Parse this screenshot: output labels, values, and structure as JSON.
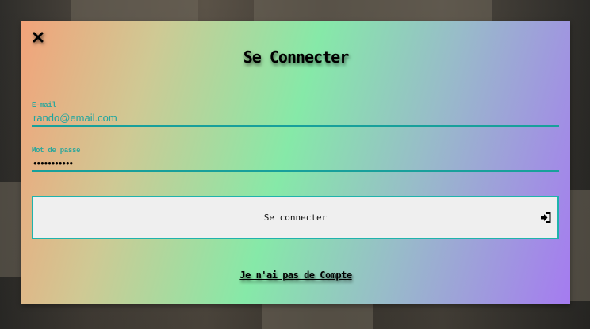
{
  "modal": {
    "title": "Se Connecter",
    "close_icon": "close-icon",
    "email": {
      "label": "E-mail",
      "value": "rando@email.com"
    },
    "password": {
      "label": "Mot de passe",
      "value": "•••••••••••"
    },
    "submit": {
      "label": "Se connecter",
      "icon": "sign-in-icon"
    },
    "no_account_link": "Je n'ai pas de Compte"
  },
  "colors": {
    "accent": "#1fb3ac",
    "label": "#2fa79b",
    "gradient": [
      "#f2a37a",
      "#86e9a8",
      "#a57bf0"
    ]
  }
}
